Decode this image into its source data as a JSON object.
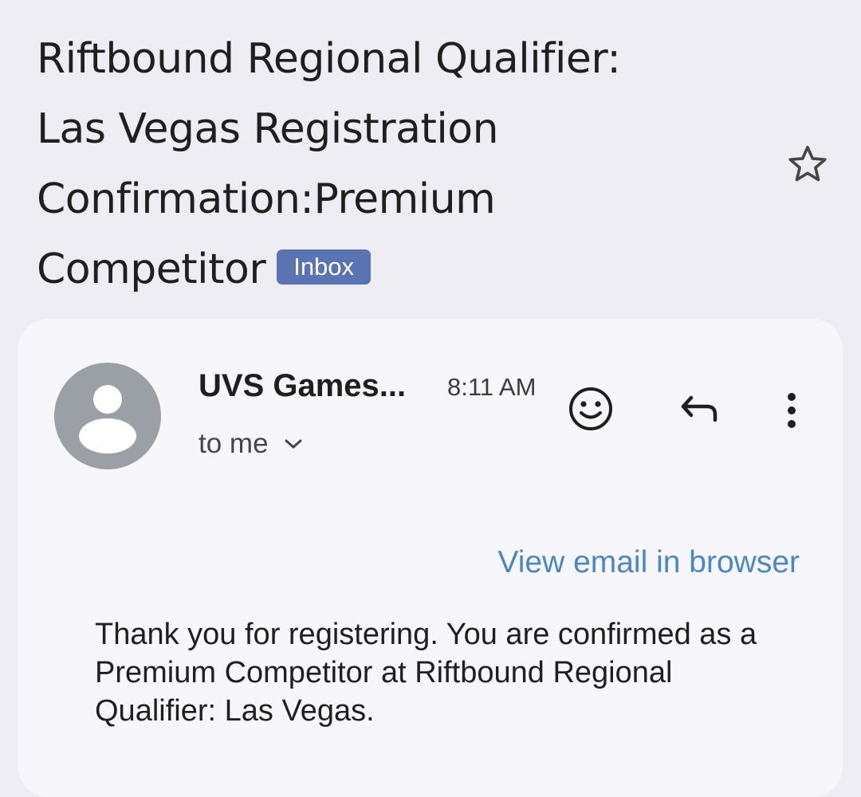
{
  "subject": {
    "lines": [
      "Riftbound Regional Qualifier:",
      "Las Vegas Registration",
      "Confirmation:Premium",
      "Competitor"
    ],
    "label": "Inbox"
  },
  "message": {
    "sender": "UVS Games...",
    "time": "8:11 AM",
    "recipient": "to me",
    "view_in_browser": "View email in browser",
    "body": "Thank you for registering. You are confirmed as a Premium Competitor at Riftbound Regional Qualifier: Las Vegas."
  },
  "icons": {
    "star": "star-outline-icon",
    "avatar": "person-icon",
    "expand": "chevron-down-icon",
    "emoji": "emoji-reaction-icon",
    "reply": "reply-icon",
    "more": "more-vert-icon"
  },
  "colors": {
    "background": "#eeedf3",
    "card": "#f6f6fb",
    "badge": "#5a73b3",
    "link": "#4a86c8",
    "avatar": "#9aa0a6"
  }
}
